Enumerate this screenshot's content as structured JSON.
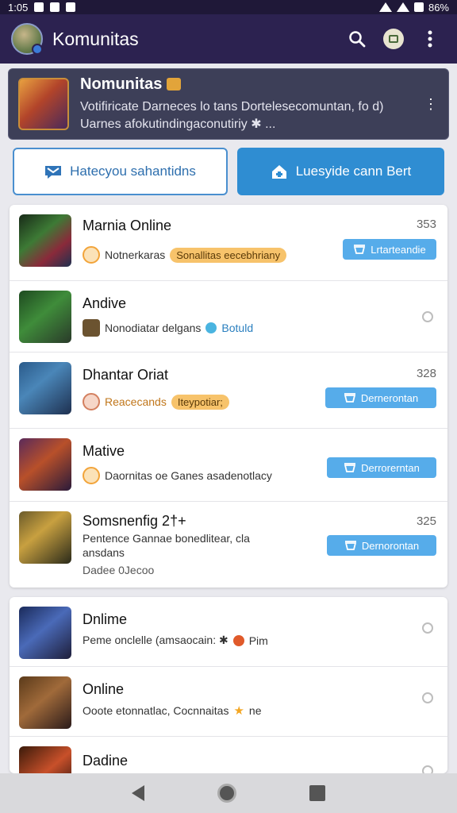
{
  "status": {
    "time": "1:05",
    "battery": "86%"
  },
  "app_bar": {
    "title": "Komunitas",
    "search_icon": "search-icon",
    "profile_icon": "camera-profile-icon",
    "menu_icon": "more-vert-icon"
  },
  "featured": {
    "title": "Nomunitas",
    "desc_line1": "Votifiricate Darneces lo tans Dortelesecomuntan, fo d)",
    "desc_line2": "Uarnes afokutindingaconutiriy ✱ ..."
  },
  "buttons": {
    "left_label": "Hatecyou sahantidns",
    "right_label": "Luesyide cann Bert"
  },
  "list_a": [
    {
      "title": "Marnia Online",
      "sub": "Notnerkaras",
      "tag": "Sonallitas eecebhriany",
      "count": "353",
      "button": "Lrtarteandie"
    },
    {
      "title": "Andive",
      "sub": "Nonodiatar delgans",
      "tag_blue": "Botuld"
    },
    {
      "title": "Dhantar Oriat",
      "sub": "Reacecands",
      "tag": "Iteypotiar;",
      "count": "328",
      "button": "Dernerontan"
    },
    {
      "title": "Mative",
      "sub": "Daornitas oe Ganes asadenotlacy",
      "button": "Derrorerntan"
    },
    {
      "title": "Somsnenfig 2†+",
      "sub": "Pentence Gannae bonedlitear, cla",
      "sub2": "ansdans",
      "meta": "Dadee 0Jecoo",
      "count": "325",
      "button": "Dernorontan"
    }
  ],
  "list_b": [
    {
      "title": "Dnlime",
      "sub": "Peme onclelle (amsaocain: ✱",
      "sub_tail": "Pim"
    },
    {
      "title": "Online",
      "sub": "Ooote etonnatlac, Cocnnaitas",
      "sub_tail": "ne"
    },
    {
      "title": "Dadine"
    }
  ]
}
